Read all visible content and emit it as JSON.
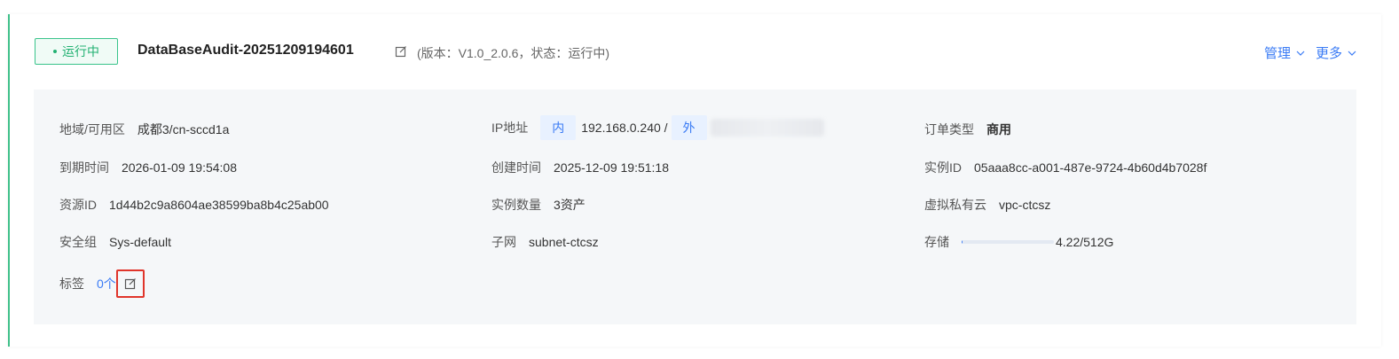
{
  "header": {
    "status_label": "运行中",
    "instance_name": "DataBaseAudit-20251209194601",
    "version_info": "(版本：V1.0_2.0.6，状态：运行中)",
    "manage_label": "管理",
    "more_label": "更多"
  },
  "details": {
    "region": {
      "label": "地域/可用区",
      "value": "成都3/cn-sccd1a"
    },
    "expire": {
      "label": "到期时间",
      "value": "2026-01-09 19:54:08"
    },
    "resource_id": {
      "label": "资源ID",
      "value": "1d44b2c9a8604ae38599ba8b4c25ab00"
    },
    "security_group": {
      "label": "安全组",
      "value": "Sys-default"
    },
    "tags": {
      "label": "标签",
      "value": "0个"
    },
    "ip": {
      "label": "IP地址",
      "inner_tag": "内",
      "inner_value": "192.168.0.240 /",
      "outer_tag": "外"
    },
    "created": {
      "label": "创建时间",
      "value": "2025-12-09 19:51:18"
    },
    "instance_count": {
      "label": "实例数量",
      "value": "3资产"
    },
    "subnet": {
      "label": "子网",
      "value": "subnet-ctcsz"
    },
    "order_type": {
      "label": "订单类型",
      "value": "商用"
    },
    "instance_id": {
      "label": "实例ID",
      "value": "05aaa8cc-a001-487e-9724-4b60d4b7028f"
    },
    "vpc": {
      "label": "虚拟私有云",
      "value": "vpc-ctcsz"
    },
    "storage": {
      "label": "存储",
      "value": "4.22/512G",
      "used_fraction": 0.0082
    }
  },
  "colors": {
    "accent": "#3a7bf5",
    "running": "#22b172",
    "highlight": "#e0352b"
  },
  "icons": {
    "edit": "edit-icon",
    "chevron": "chevron-down-icon"
  }
}
